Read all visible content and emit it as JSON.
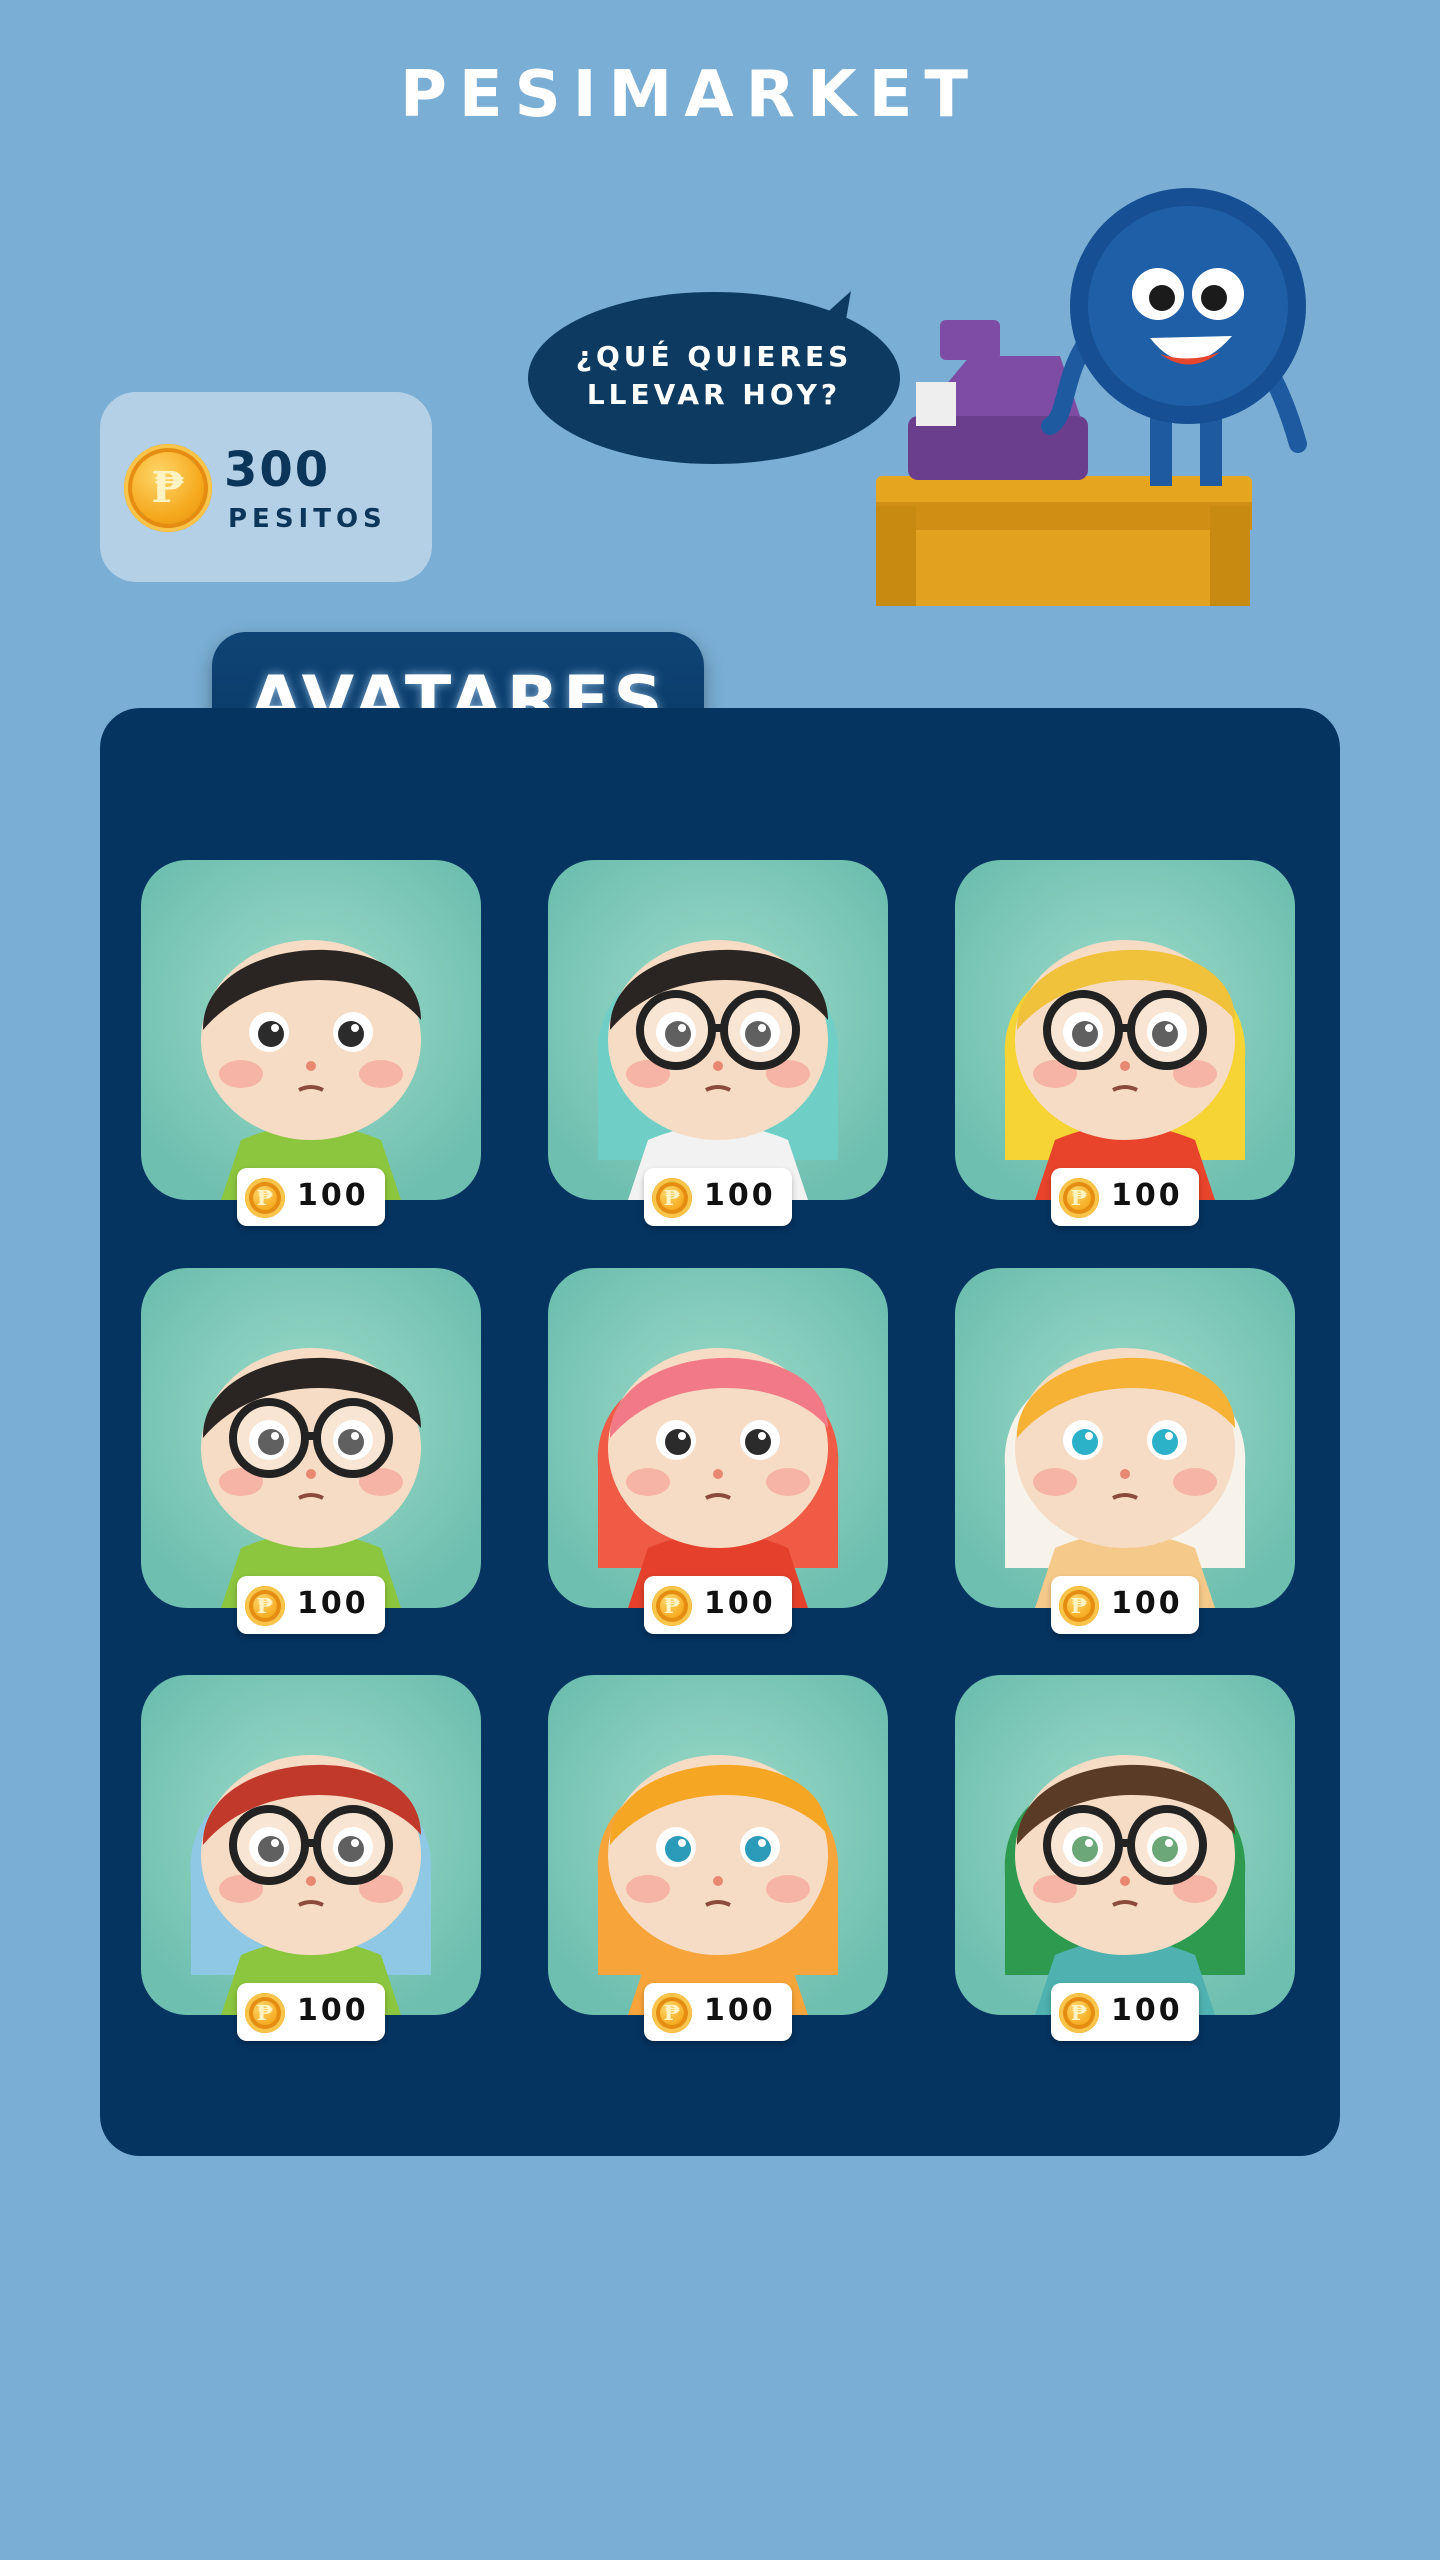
{
  "app": {
    "title": "PESIMARKET"
  },
  "balance": {
    "amount": "300",
    "unit": "PESITOS",
    "coin_icon": "peso-coin-icon"
  },
  "mascot": {
    "speech_line1": "¿QUÉ QUIERES",
    "speech_line2": "LLEVAR HOY?"
  },
  "section": {
    "title": "AVATARES"
  },
  "avatars": [
    {
      "price": "100",
      "hair": "#2a2522",
      "hood": "none",
      "shirt": "#8cc63f",
      "eyes": "#2b2b2b",
      "glasses": false
    },
    {
      "price": "100",
      "hair": "#2a2522",
      "hood": "#6fcfc7",
      "shirt": "#f2f2f2",
      "eyes": "#2b2b2b",
      "glasses": true
    },
    {
      "price": "100",
      "hair": "#f0c23b",
      "hood": "#f5d434",
      "shirt": "#e8432b",
      "eyes": "#2b2b2b",
      "glasses": true
    },
    {
      "price": "100",
      "hair": "#2a2522",
      "hood": "none",
      "shirt": "#8cc63f",
      "eyes": "#2b2b2b",
      "glasses": true
    },
    {
      "price": "100",
      "hair": "#f27a86",
      "hood": "#ef5b45",
      "shirt": "#e4402c",
      "eyes": "#2b2b2b",
      "glasses": false
    },
    {
      "price": "100",
      "hair": "#f5b235",
      "hood": "#f7f2ea",
      "shirt": "#f5c98a",
      "eyes": "#2bb2c9",
      "glasses": false
    },
    {
      "price": "100",
      "hair": "#c0392b",
      "hood": "#8fc8e4",
      "shirt": "#8cc63f",
      "eyes": "#2b2b2b",
      "glasses": true
    },
    {
      "price": "100",
      "hair": "#f5a623",
      "hood": "#f7a53a",
      "shirt": "#f7a53a",
      "eyes": "#2a9bb8",
      "glasses": false
    },
    {
      "price": "100",
      "hair": "#5a3b26",
      "hood": "#2e9a4f",
      "shirt": "#4fb2b0",
      "eyes": "#3a8a4a",
      "glasses": true
    }
  ],
  "colors": {
    "background": "#7aaed4",
    "panel": "#053461",
    "accent_coin": "#f5a81c"
  }
}
